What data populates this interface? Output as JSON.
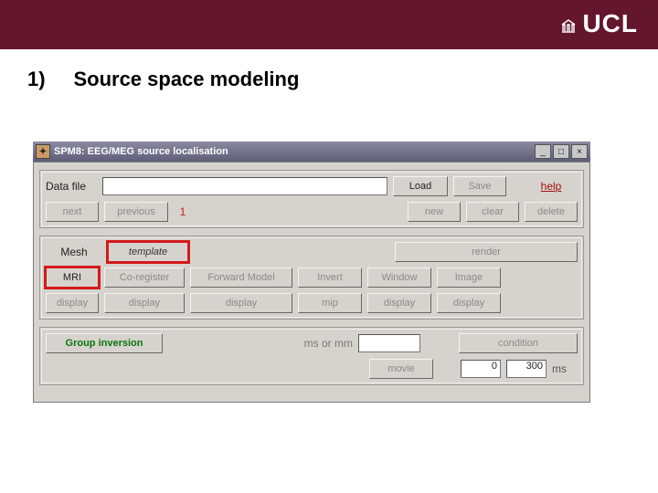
{
  "brand": {
    "name": "UCL",
    "portico_glyph": "⛪"
  },
  "heading": {
    "number": "1)",
    "title": "Source space modeling"
  },
  "window": {
    "title": "SPM8: EEG/MEG source localisation",
    "icon_glyph": "✦",
    "buttons": {
      "min": "_",
      "max": "□",
      "close": "×"
    }
  },
  "panel1": {
    "datafile_label": "Data file",
    "datafile_value": "",
    "load": "Load",
    "save": "Save",
    "help": "help",
    "next": "next",
    "previous": "previous",
    "index": "1",
    "new": "new",
    "clear": "clear",
    "delete": "delete"
  },
  "panel2": {
    "mesh_label": "Mesh",
    "template": "template",
    "render": "render",
    "mri": "MRI",
    "coregister": "Co-register",
    "forward": "Forward Model",
    "invert": "Invert",
    "window_btn": "Window",
    "image": "Image",
    "display1": "display",
    "display2": "display",
    "display3": "display",
    "mip": "mip",
    "display4": "display",
    "display5": "display"
  },
  "panel3": {
    "group_inv": "Group inversion",
    "ms_or_mm": "ms or mm",
    "ms_or_mm_value": "",
    "condition": "condition",
    "movie": "movie",
    "t_from": "0",
    "t_to": "300",
    "t_unit": "ms"
  }
}
